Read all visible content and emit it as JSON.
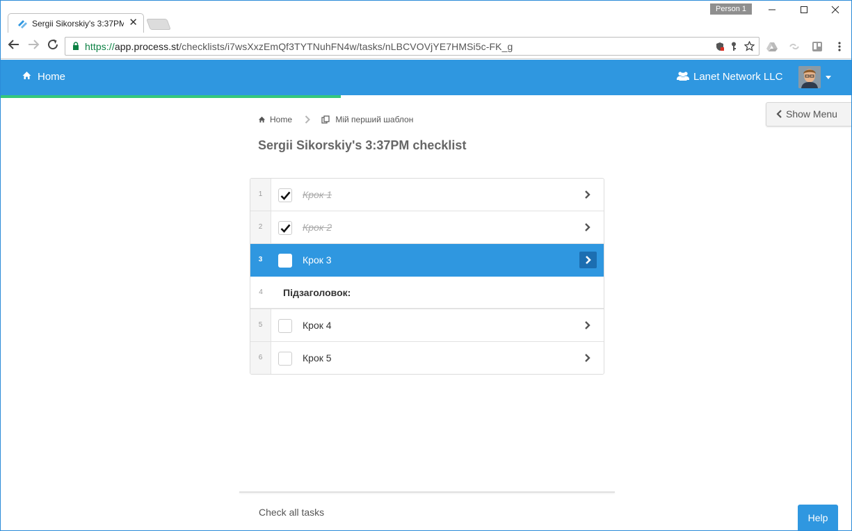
{
  "browser": {
    "tab_title": "Sergii Sikorskiy's 3:37PM",
    "tab_close": "✕",
    "profile": "Person 1",
    "url_scheme": "https://",
    "url_host": "app.process.st",
    "url_path": "/checklists/i7wsXxzEmQf3TYTNuhFN4w/tasks/nLBCVOVjYE7HMSi5c-FK_g"
  },
  "navbar": {
    "home_label": "Home",
    "org_label": "Lanet Network LLC"
  },
  "show_menu_label": "Show Menu",
  "breadcrumb": {
    "home": "Home",
    "template": "Мій перший шаблон"
  },
  "page_title": "Sergii Sikorskiy's 3:37PM checklist",
  "tasks": [
    {
      "num": "1",
      "label": "Крок 1",
      "checked": true
    },
    {
      "num": "2",
      "label": "Крок 2",
      "checked": true
    },
    {
      "num": "3",
      "label": "Крок 3",
      "checked": false,
      "active": true
    },
    {
      "num": "4",
      "label": "Підзаголовок:",
      "heading": true
    },
    {
      "num": "5",
      "label": "Крок 4",
      "checked": false
    },
    {
      "num": "6",
      "label": "Крок 5",
      "checked": false
    }
  ],
  "footer": {
    "check_all": "Check all tasks",
    "help": "Help"
  },
  "colors": {
    "brand": "#2f97e0",
    "progress": "#35c77b"
  }
}
